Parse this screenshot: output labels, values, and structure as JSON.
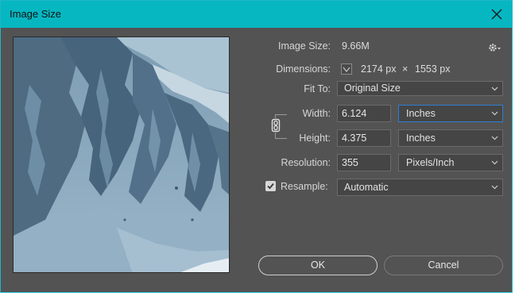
{
  "window": {
    "title": "Image Size"
  },
  "info": {
    "image_size_label": "Image Size:",
    "image_size_value": "9.66M",
    "dimensions_label": "Dimensions:",
    "dim_width": "2174 px",
    "dim_times": "×",
    "dim_height": "1553 px"
  },
  "fit_to": {
    "label": "Fit To:",
    "value": "Original Size"
  },
  "width": {
    "label": "Width:",
    "value": "6.124",
    "unit": "Inches"
  },
  "height": {
    "label": "Height:",
    "value": "4.375",
    "unit": "Inches"
  },
  "resolution": {
    "label": "Resolution:",
    "value": "355",
    "unit": "Pixels/Inch"
  },
  "resample": {
    "label": "Resample:",
    "checked": true,
    "value": "Automatic"
  },
  "buttons": {
    "ok": "OK",
    "cancel": "Cancel"
  },
  "icons": {
    "close": "close-icon",
    "gear": "gear-icon",
    "link": "chain-link-icon",
    "chevron": "chevron-down-icon",
    "check": "checkmark-icon"
  },
  "colors": {
    "titlebar": "#06b7c1",
    "dialog_bg": "#535353",
    "focus": "#2f7fd5"
  }
}
